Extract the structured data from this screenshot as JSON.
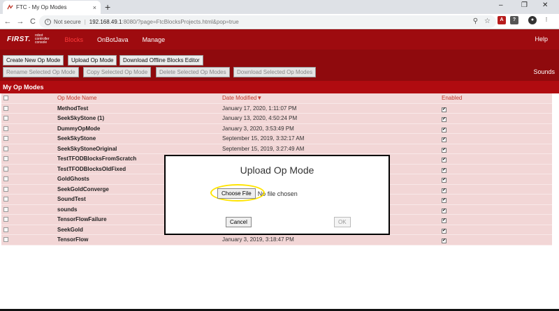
{
  "browser": {
    "tab_title": "FTC - My Op Modes",
    "tab_close": "×",
    "new_tab": "+",
    "not_secure": "Not secure",
    "url_host": "192.168.49.1",
    "url_rest": ":8080/?page=FtcBlocksProjects.html&pop=true",
    "back": "←",
    "forward": "→",
    "reload": "C",
    "zoom_icon": "⚲",
    "star_icon": "☆",
    "menu_icon": "⋮",
    "min": "–",
    "max": "❐",
    "close": "✕"
  },
  "nav": {
    "logo_first": "FIRST.",
    "logo_line1": "robot",
    "logo_line2": "controller",
    "logo_line3": "console",
    "blocks": "Blocks",
    "onbotjava": "OnBotJava",
    "manage": "Manage",
    "help": "Help"
  },
  "toolbar": {
    "create": "Create New Op Mode",
    "upload": "Upload Op Mode",
    "download_offline": "Download Offline Blocks Editor",
    "rename": "Rename Selected Op Mode",
    "copy": "Copy Selected Op Mode",
    "delete": "Delete Selected Op Modes",
    "download_selected": "Download Selected Op Modes",
    "sounds": "Sounds"
  },
  "section_title": "My Op Modes",
  "table": {
    "headers": {
      "name": "Op Mode Name",
      "date": "Date Modified▼",
      "enabled": "Enabled"
    },
    "check_mark": "✔",
    "rows": [
      {
        "name": "MethodTest",
        "date": "January 17, 2020, 1:11:07 PM"
      },
      {
        "name": "SeekSkyStone (1)",
        "date": "January 13, 2020, 4:50:24 PM"
      },
      {
        "name": "DummyOpMode",
        "date": "January 3, 2020, 3:53:49 PM"
      },
      {
        "name": "SeekSkyStone",
        "date": "September 15, 2019, 3:32:17 AM"
      },
      {
        "name": "SeekSkyStoneOriginal",
        "date": "September 15, 2019, 3:27:49 AM"
      },
      {
        "name": "TestTFODBlocksFromScratch",
        "date": ""
      },
      {
        "name": "TestTFODBlocksOldFixed",
        "date": ""
      },
      {
        "name": "GoldGhosts",
        "date": ""
      },
      {
        "name": "SeekGoldConverge",
        "date": ""
      },
      {
        "name": "SoundTest",
        "date": ""
      },
      {
        "name": "sounds",
        "date": ""
      },
      {
        "name": "TensorFlowFailure",
        "date": ""
      },
      {
        "name": "SeekGold",
        "date": ""
      },
      {
        "name": "TensorFlow",
        "date": "January 3, 2019, 3:18:47 PM"
      }
    ]
  },
  "modal": {
    "title": "Upload Op Mode",
    "choose_file": "Choose File",
    "no_file": "No file chosen",
    "cancel": "Cancel",
    "ok": "OK"
  },
  "colors": {
    "nav_bg": "#9e0b0f",
    "toolbar_bg": "#8f0a0d",
    "section_bg": "#b00b10",
    "row_bg": "#f2d6d6",
    "highlight": "#ffe400"
  }
}
